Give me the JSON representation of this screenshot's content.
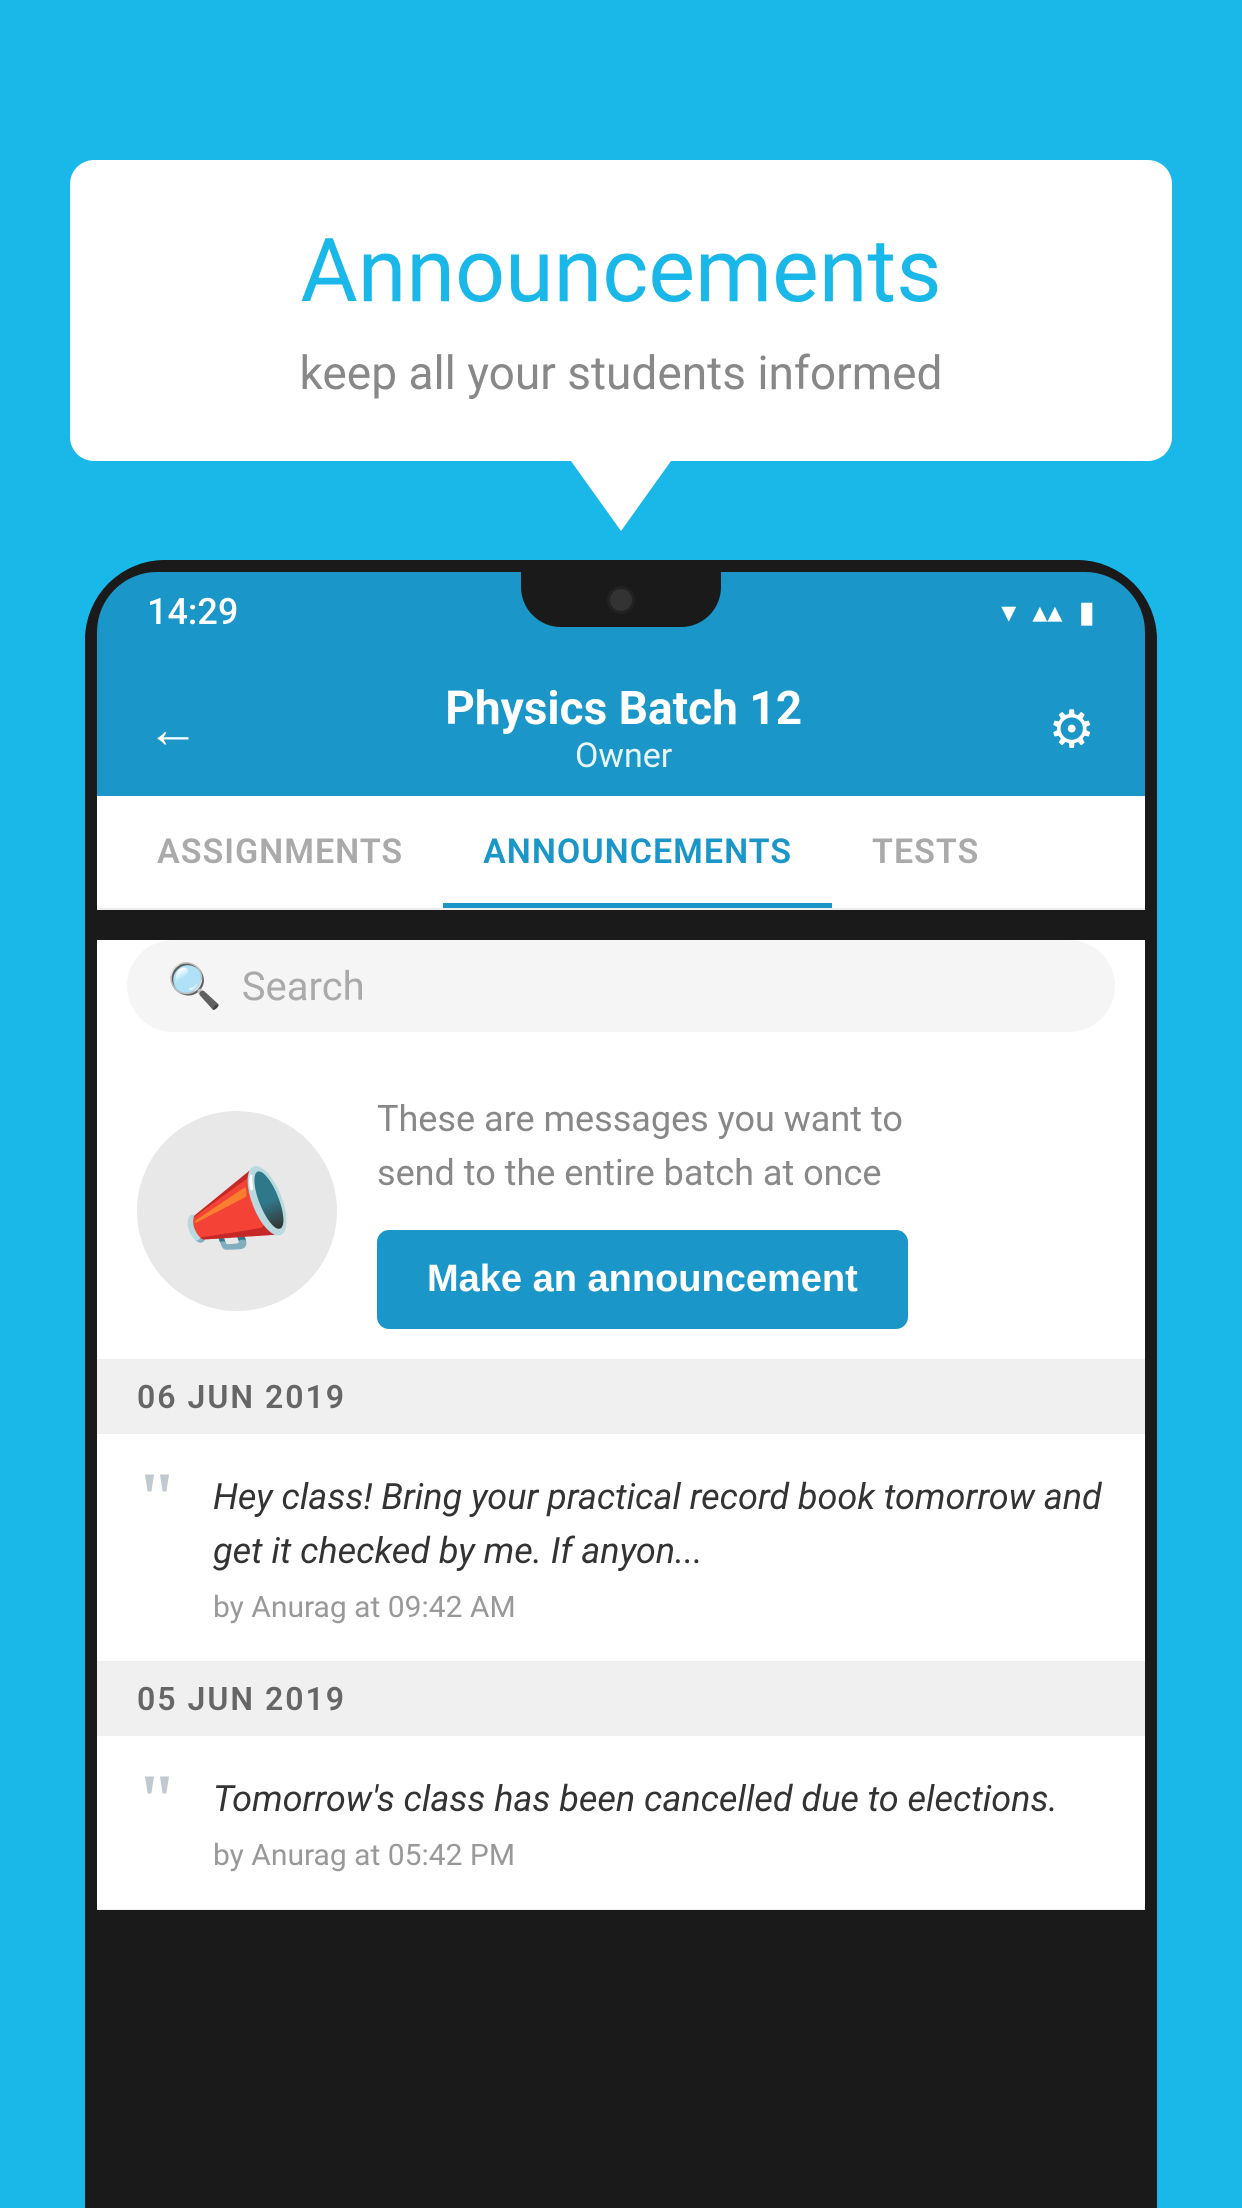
{
  "page": {
    "background_color": "#1ab8e8"
  },
  "speech_bubble": {
    "title": "Announcements",
    "subtitle": "keep all your students informed",
    "title_color": "#1ab8e8",
    "subtitle_color": "#888888"
  },
  "phone": {
    "status_bar": {
      "time": "14:29",
      "wifi_icon": "▼",
      "signal_icon": "▲",
      "battery_icon": "▮"
    },
    "header": {
      "back_label": "←",
      "title": "Physics Batch 12",
      "subtitle": "Owner",
      "gear_icon": "⚙"
    },
    "tabs": [
      {
        "label": "ASSIGNMENTS",
        "active": false
      },
      {
        "label": "ANNOUNCEMENTS",
        "active": true
      },
      {
        "label": "TESTS",
        "active": false
      },
      {
        "label": "...",
        "active": false
      }
    ],
    "search": {
      "placeholder": "Search"
    },
    "promo": {
      "description_line1": "These are messages you want to",
      "description_line2": "send to the entire batch at once",
      "button_label": "Make an announcement"
    },
    "announcements": [
      {
        "date": "06  JUN  2019",
        "text": "Hey class! Bring your practical record book tomorrow and get it checked by me. If anyon...",
        "meta": "by Anurag at 09:42 AM"
      },
      {
        "date": "05  JUN  2019",
        "text": "Tomorrow's class has been cancelled due to elections.",
        "meta": "by Anurag at 05:42 PM"
      }
    ]
  }
}
